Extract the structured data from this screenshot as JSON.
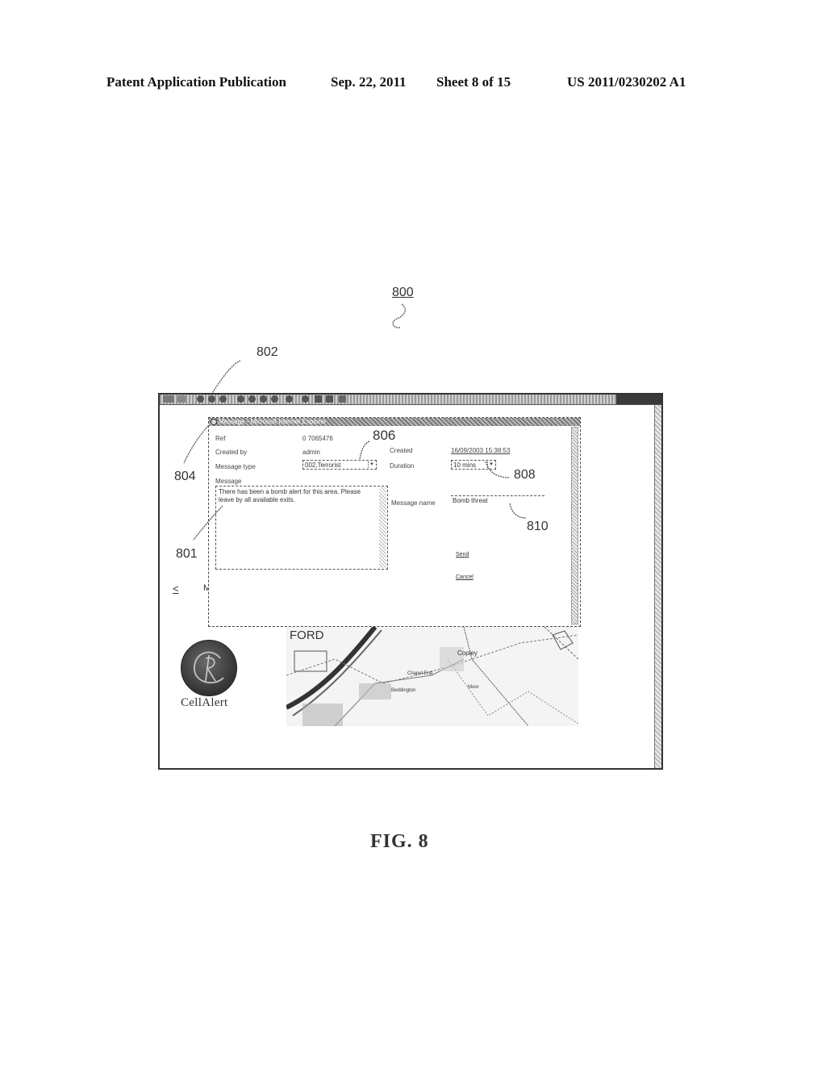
{
  "header": {
    "publication": "Patent Application Publication",
    "date": "Sep. 22, 2011",
    "sheet": "Sheet 8 of 15",
    "number": "US 2011/0230202 A1"
  },
  "reference_numerals": {
    "figure": "800",
    "toolbar": "802",
    "ref_field": "804",
    "message_type": "806",
    "duration": "808",
    "message_name": "810",
    "message_box": "801"
  },
  "browser": {
    "nav_back": "<",
    "nav_item": "M"
  },
  "dialog": {
    "title": "Message - Microsoft Internet Explorer",
    "fields": {
      "ref_label": "Ref",
      "ref_value": "0 7065476",
      "created_by_label": "Created by",
      "created_by_value": "admin",
      "created_label": "Created",
      "created_value": "16/09/2003 15:38:53",
      "message_type_label": "Message type",
      "message_type_value": "002,Terrorist",
      "duration_label": "Duration",
      "duration_value": "10 mins",
      "message_label": "Message",
      "message_text": "There has been a bomb alert for this area. Please leave by all available exits.",
      "message_name_label": "Message name",
      "message_name_value": "Bomb threat"
    },
    "actions": {
      "send": "Send",
      "cancel": "Cancel"
    }
  },
  "logo": {
    "text": "CellAlert"
  },
  "map": {
    "labels": [
      "FORD",
      "Copley",
      "Chapel End",
      "Moor",
      "Beddington"
    ]
  },
  "caption": "FIG. 8"
}
